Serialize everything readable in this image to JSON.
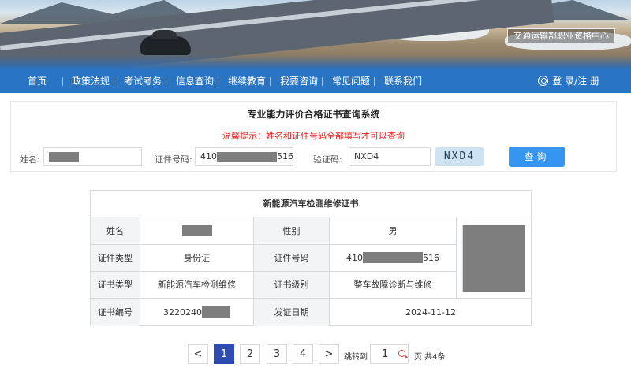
{
  "banner": {
    "org_label": "交通运输部职业资格中心"
  },
  "nav": {
    "items": [
      "首页",
      "政策法规",
      "考试考务",
      "信息查询",
      "继续教育",
      "我要咨询",
      "常见问题",
      "联系我们"
    ],
    "login_label": "登 录/注 册"
  },
  "query": {
    "title": "专业能力评价合格证书查询系统",
    "hint": "温馨提示：姓名和证件号码全部填写才可以查询",
    "name_label": "姓名:",
    "id_label": "证件号码:",
    "id_prefix": "410",
    "id_suffix": "516",
    "captcha_label": "验证码:",
    "captcha_value": "NXD4",
    "captcha_image_text": "NXD4",
    "button_label": "查询"
  },
  "certificate": {
    "title": "新能源汽车检测维修证书",
    "rows": [
      {
        "l1": "姓名",
        "v1": "",
        "l2": "性别",
        "v2": "男"
      },
      {
        "l1": "证件类型",
        "v1": "身份证",
        "l2": "证件号码",
        "v2_prefix": "410",
        "v2_suffix": "516"
      },
      {
        "l1": "证书类型",
        "v1": "新能源汽车检测维修",
        "l2": "证书级别",
        "v2": "整车故障诊断与维修"
      },
      {
        "l1": "证书编号",
        "v1_prefix": "3220240",
        "l2": "发证日期",
        "v2": "2024-11-12"
      }
    ]
  },
  "pagination": {
    "prev": "<",
    "pages": [
      "1",
      "2",
      "3",
      "4"
    ],
    "current_page": 1,
    "next": ">",
    "jump_label": "跳转到",
    "jump_value": "1",
    "total_label": "页 共4条"
  },
  "colors": {
    "nav_bg": "#2a74c4",
    "primary_button": "#3595f0",
    "active_page": "#2d4bb0",
    "hint": "#e32020"
  }
}
